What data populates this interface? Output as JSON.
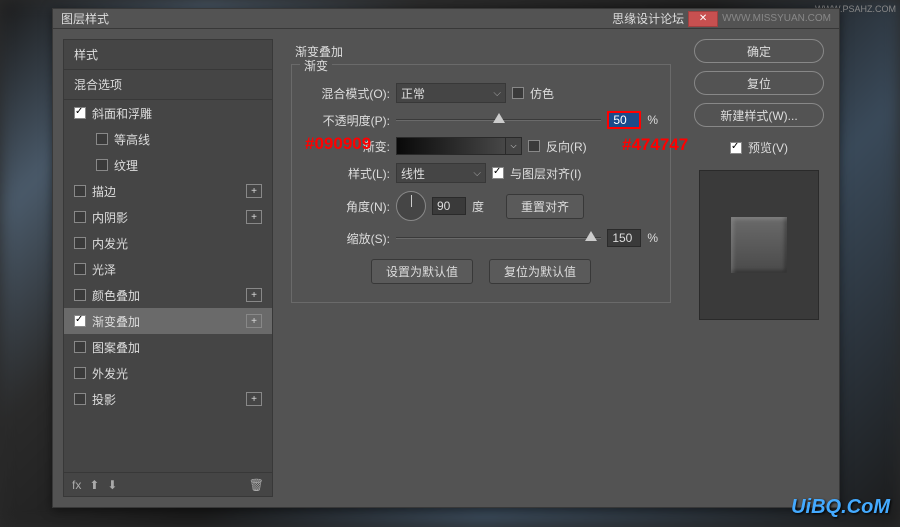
{
  "window": {
    "title": "图层样式",
    "forum": "思缘设计论坛",
    "site": "WWW.MISSYUAN.COM"
  },
  "left": {
    "styles_header": "样式",
    "blend_options": "混合选项",
    "items": [
      {
        "label": "斜面和浮雕",
        "checked": true
      },
      {
        "label": "等高线",
        "checked": false,
        "sub": true
      },
      {
        "label": "纹理",
        "checked": false,
        "sub": true
      },
      {
        "label": "描边",
        "checked": false,
        "plus": true
      },
      {
        "label": "内阴影",
        "checked": false,
        "plus": true
      },
      {
        "label": "内发光",
        "checked": false
      },
      {
        "label": "光泽",
        "checked": false
      },
      {
        "label": "颜色叠加",
        "checked": false,
        "plus": true
      },
      {
        "label": "渐变叠加",
        "checked": true,
        "selected": true,
        "plus": true
      },
      {
        "label": "图案叠加",
        "checked": false
      },
      {
        "label": "外发光",
        "checked": false
      },
      {
        "label": "投影",
        "checked": false,
        "plus": true
      }
    ],
    "footer_fx": "fx"
  },
  "center": {
    "section_title": "渐变叠加",
    "fieldset_legend": "渐变",
    "blend_mode_label": "混合模式(O):",
    "blend_mode_value": "正常",
    "dither_label": "仿色",
    "opacity_label": "不透明度(P):",
    "opacity_value": "50",
    "opacity_unit": "%",
    "gradient_label": "渐变:",
    "reverse_label": "反向(R)",
    "style_label": "样式(L):",
    "style_value": "线性",
    "align_label": "与图层对齐(I)",
    "angle_label": "角度(N):",
    "angle_value": "90",
    "angle_unit": "度",
    "reset_align": "重置对齐",
    "scale_label": "缩放(S):",
    "scale_value": "150",
    "scale_unit": "%",
    "set_default": "设置为默认值",
    "reset_default": "复位为默认值"
  },
  "right": {
    "ok": "确定",
    "cancel": "复位",
    "new_style": "新建样式(W)...",
    "preview": "预览(V)"
  },
  "annotations": {
    "color_left": "#090909",
    "color_right": "#474747"
  },
  "watermark": "UiBQ.CoM"
}
